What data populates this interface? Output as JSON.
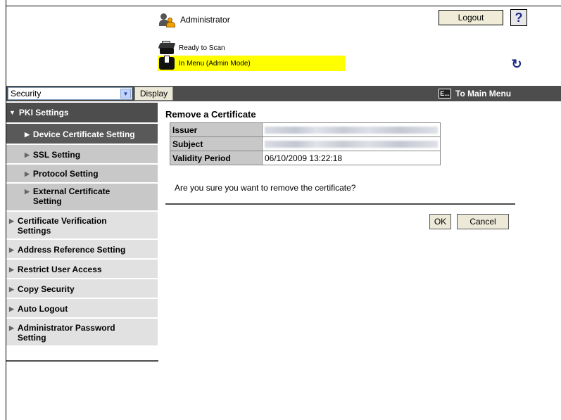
{
  "header": {
    "user_label": "Administrator",
    "logout_label": "Logout",
    "help_label": "?",
    "status_ready": "Ready to Scan",
    "status_menu": "In Menu (Admin Mode)",
    "status_menu_color": "#ffff00"
  },
  "navbar": {
    "select_value": "Security",
    "display_label": "Display",
    "main_menu_label": "To Main Menu"
  },
  "sidebar": {
    "header": "PKI Settings",
    "sub_items": [
      {
        "label": "Device Certificate Setting",
        "active": true
      },
      {
        "label": "SSL Setting",
        "active": false
      },
      {
        "label": "Protocol Setting",
        "active": false
      },
      {
        "label": "External Certificate Setting",
        "active": false
      }
    ],
    "items": [
      {
        "label": "Certificate Verification Settings"
      },
      {
        "label": "Address Reference Setting"
      },
      {
        "label": "Restrict User Access"
      },
      {
        "label": "Copy Security"
      },
      {
        "label": "Auto Logout"
      },
      {
        "label": "Administrator Password Setting"
      }
    ]
  },
  "main": {
    "title": "Remove a Certificate",
    "rows": [
      {
        "label": "Issuer",
        "value": "",
        "blurred": true
      },
      {
        "label": "Subject",
        "value": "",
        "blurred": true
      },
      {
        "label": "Validity Period",
        "value": "06/10/2009 13:22:18",
        "blurred": false
      }
    ],
    "question": "Are you sure you want to remove the certificate?",
    "ok_label": "OK",
    "cancel_label": "Cancel"
  },
  "colors": {
    "navbar_bg": "#4d4d4d",
    "sidebar_active_bg": "#595959",
    "sidebar_sub_bg": "#c8c8c8",
    "sidebar_item_bg": "#e1e1e1"
  }
}
